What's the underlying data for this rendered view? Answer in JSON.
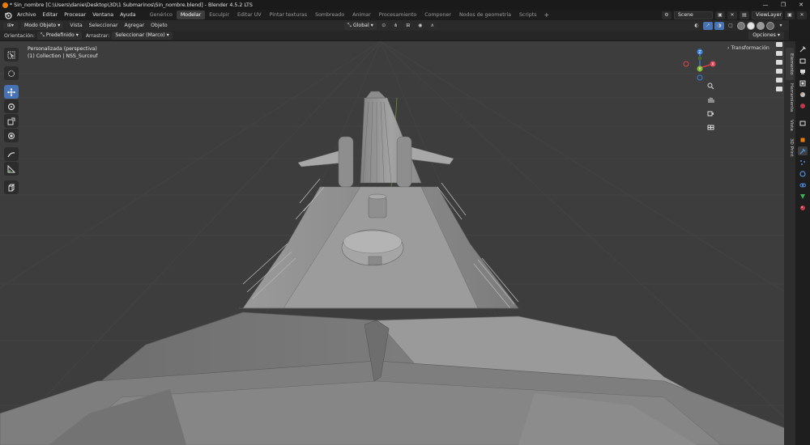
{
  "window": {
    "title": "* Sin_nombre [C:\\Users\\danie\\Desktop\\3D\\1 Submarinos\\Sin_nombre.blend] - Blender 4.5.2 LTS",
    "controls": [
      "—",
      "❐",
      "✕"
    ]
  },
  "menu": {
    "items": [
      "Archivo",
      "Editar",
      "Procesar",
      "Ventana",
      "Ayuda"
    ],
    "workspaces": [
      "Genérico",
      "Modelar",
      "Esculpir",
      "Editar UV",
      "Pintar texturas",
      "Sombreado",
      "Animar",
      "Procesamiento",
      "Componer",
      "Nodos de geometría",
      "Scripts"
    ],
    "active_workspace": "Modelar",
    "add_tab": "+",
    "scene": "Scene",
    "view_layer": "ViewLayer"
  },
  "viewport_header": {
    "mode": "Modo Objeto",
    "menus": [
      "Vista",
      "Seleccionar",
      "Agregar",
      "Objeto"
    ],
    "orientation": "Global"
  },
  "tool_settings": {
    "orientation_label": "Orientación:",
    "orientation_value": "Predefinido",
    "drag_label": "Arrastrar:",
    "drag_value": "Seleccionar (Marco)",
    "options": "Opciones"
  },
  "viewport": {
    "view_name": "Personalizada (perspectiva)",
    "collection_info": "(1) Collection | NSS_Surcouf",
    "transform_panel": "Transformación",
    "gizmo": {
      "x": "X",
      "y": "Y",
      "z": "Z"
    }
  },
  "sidebar_tabs": [
    "Elemento",
    "Herramienta",
    "Vista",
    "3D Print"
  ],
  "colors": {
    "active_blue": "#4772b3",
    "axis_x": "#e0434f",
    "axis_y": "#7fb832",
    "axis_z": "#3b7fe0",
    "viewport_bg": "#3d3d3d",
    "mesh_gray": "#8a8a8a"
  }
}
